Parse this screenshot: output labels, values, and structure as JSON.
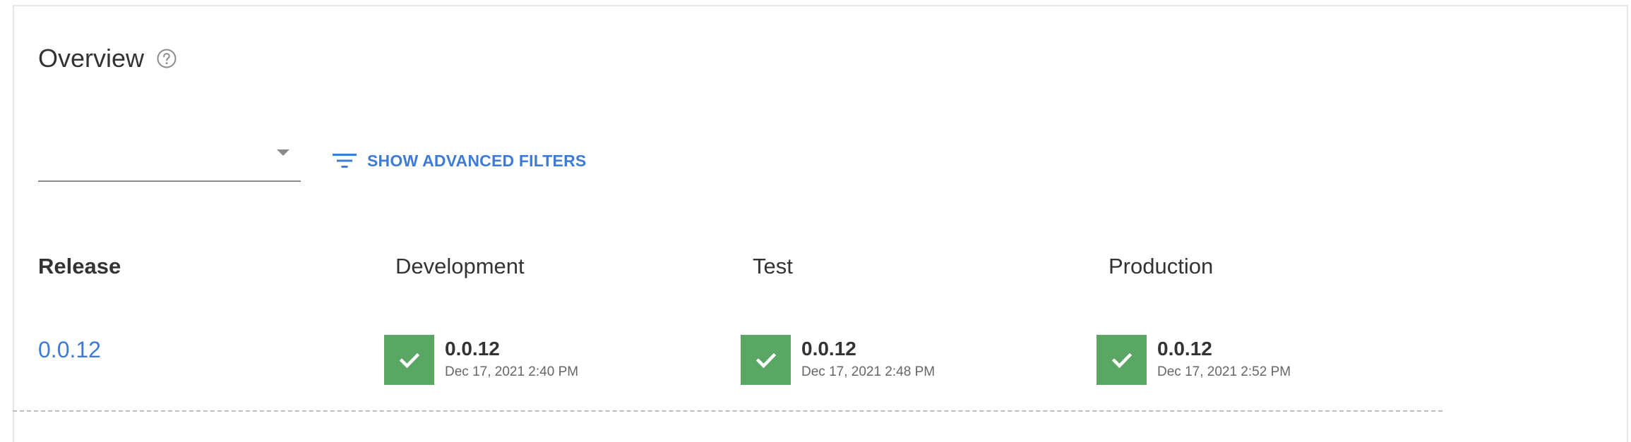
{
  "overview": {
    "title": "Overview",
    "help_icon": "help-circle-icon"
  },
  "filters": {
    "select_value": "",
    "caret_icon": "caret-down-icon",
    "advanced_label": "SHOW ADVANCED FILTERS",
    "advanced_icon": "filter-lines-icon",
    "accent_color": "#3d7bd7"
  },
  "table": {
    "headers": {
      "release": "Release",
      "development": "Development",
      "test": "Test",
      "production": "Production"
    },
    "rows": [
      {
        "release": "0.0.12",
        "development": {
          "status": "success",
          "status_icon": "check-icon",
          "version": "0.0.12",
          "date": "Dec 17, 2021 2:40 PM"
        },
        "test": {
          "status": "success",
          "status_icon": "check-icon",
          "version": "0.0.12",
          "date": "Dec 17, 2021 2:48 PM"
        },
        "production": {
          "status": "success",
          "status_icon": "check-icon",
          "version": "0.0.12",
          "date": "Dec 17, 2021 2:52 PM"
        }
      }
    ],
    "success_color": "#5aa764"
  }
}
